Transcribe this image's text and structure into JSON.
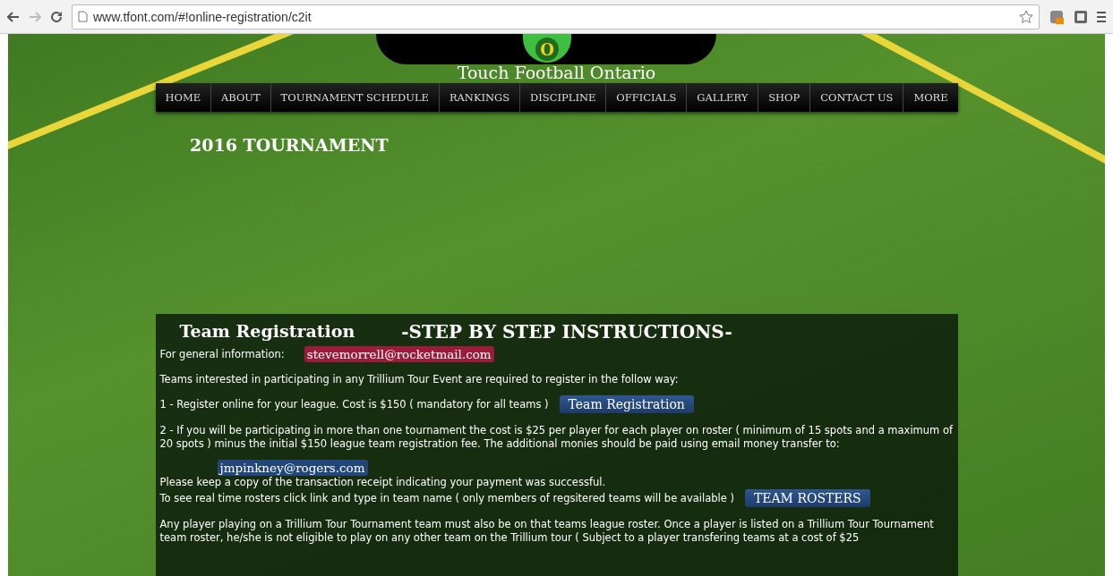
{
  "browser": {
    "url": "www.tfont.com/#!online-registration/c2it"
  },
  "site": {
    "title": "Touch Football Ontario",
    "logo_letter": "O"
  },
  "nav": [
    {
      "label": "HOME",
      "selected": false
    },
    {
      "label": "ABOUT",
      "selected": false
    },
    {
      "label": "TOURNAMENT SCHEDULE",
      "selected": false
    },
    {
      "label": "RANKINGS",
      "selected": false
    },
    {
      "label": "DISCIPLINE",
      "selected": false
    },
    {
      "label": "OFFICIALS",
      "selected": false
    },
    {
      "label": "GALLERY",
      "selected": false
    },
    {
      "label": "SHOP",
      "selected": false
    },
    {
      "label": "CONTACT US",
      "selected": false
    },
    {
      "label": "MORE",
      "selected": false
    }
  ],
  "page_heading": "2016 TOURNAMENT",
  "panel": {
    "title": "Team Registration",
    "subtitle": "-STEP BY STEP INSTRUCTIONS-",
    "general_info": {
      "label": "For general information:",
      "email": "stevemorrell@rocketmail.com"
    },
    "intro": "Teams interested in participating in any Trillium Tour Event are required to register in the follow way:",
    "step_1": {
      "text": "1 - Register online for your league. Cost is $150 ( mandatory for all teams )",
      "button": "Team Registration"
    },
    "step_2": "2 - If you will be participating in more than one tournament the cost is $25 per player for each player on roster ( minimum of 15 spots and a maximum of 20 spots ) minus the initial $150 league team registration fee. The additional monies should be paid using email money transfer  to:",
    "transfer_email": "jmpinkney@rogers.com",
    "receipt_note": "Please keep a copy of the transaction receipt indicating your payment was successful.",
    "rosters": {
      "text": "To see real time rosters click link and type in team name ( only members of regsitered teams will be available )",
      "button": "TEAM ROSTERS"
    },
    "roster_rule": "Any player playing on a Trillium Tour Tournament team must also be on that teams league roster. Once a player is listed on a Trillium Tour Tournament team roster, he/she is not eligible to play on any other team on the Trillium tour ( Subject to a player transfering teams at a cost of $25"
  }
}
